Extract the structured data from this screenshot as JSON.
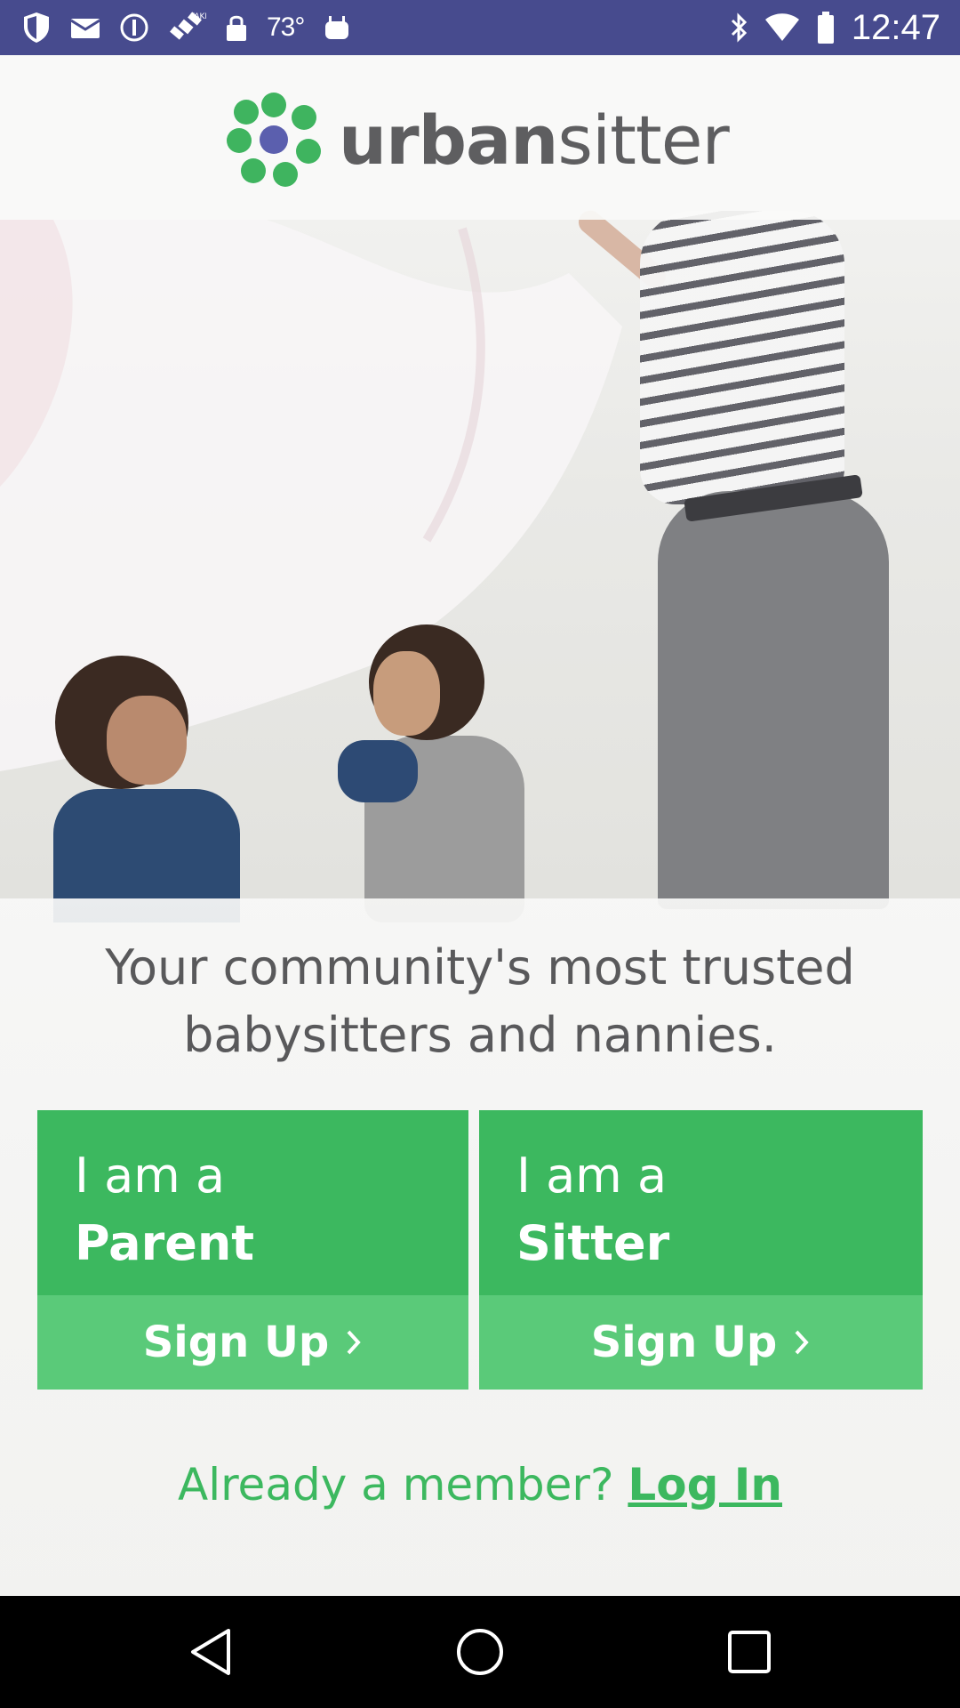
{
  "status_bar": {
    "temperature": "73°",
    "time": "12:47",
    "left_icons": [
      "shield-icon",
      "mail-icon",
      "alert-circle-icon",
      "fake-gps-satellite-icon",
      "lock-icon"
    ],
    "right_icons": [
      "bluetooth-icon",
      "wifi-icon",
      "battery-icon"
    ],
    "background": "#474b8e"
  },
  "header": {
    "logo_text_bold": "urban",
    "logo_text_regular": "sitter",
    "logo_colors": {
      "green": "#3fb45f",
      "purple": "#5b5fae"
    }
  },
  "tagline": {
    "line1": "Your community's most trusted",
    "line2": "babysitters and nannies."
  },
  "cards": {
    "parent": {
      "prefix": "I am a",
      "role": "Parent",
      "cta": "Sign Up"
    },
    "sitter": {
      "prefix": "I am a",
      "role": "Sitter",
      "cta": "Sign Up"
    }
  },
  "member": {
    "prompt": "Already a member?",
    "login": "Log In"
  },
  "colors": {
    "brand_green": "#3cb85f",
    "brand_green_light": "#5aca79",
    "text_gray": "#59595b"
  },
  "nav": {
    "buttons": [
      "back-icon",
      "home-icon",
      "recents-icon"
    ]
  }
}
